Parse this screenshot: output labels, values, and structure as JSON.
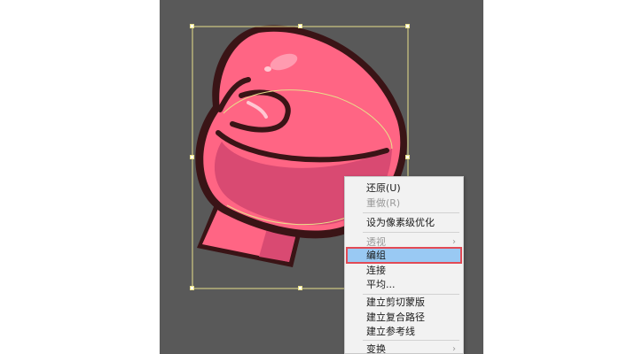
{
  "colors": {
    "canvas": "#595959",
    "glove_fill": "#ff6584",
    "glove_shade": "#d94a72",
    "glove_outline": "#3a1416",
    "selection": "#e8e08a",
    "menu_highlight": "#99c9f3",
    "highlight_border": "#e24a55"
  },
  "context_menu": {
    "items": [
      {
        "label": "还原(U)",
        "enabled": true
      },
      {
        "label": "重做(R)",
        "enabled": false
      },
      {
        "label": "设为像素级优化",
        "enabled": true
      },
      {
        "label": "透视",
        "enabled": false,
        "submenu_icon": "chevron-right-icon"
      },
      {
        "label": "编组",
        "enabled": true,
        "highlighted": true
      },
      {
        "label": "连接",
        "enabled": true
      },
      {
        "label": "平均...",
        "enabled": true
      },
      {
        "label": "建立剪切蒙版",
        "enabled": true
      },
      {
        "label": "建立复合路径",
        "enabled": true
      },
      {
        "label": "建立参考线",
        "enabled": true
      },
      {
        "label": "变换",
        "enabled": true,
        "submenu_icon": "chevron-right-icon"
      }
    ]
  }
}
